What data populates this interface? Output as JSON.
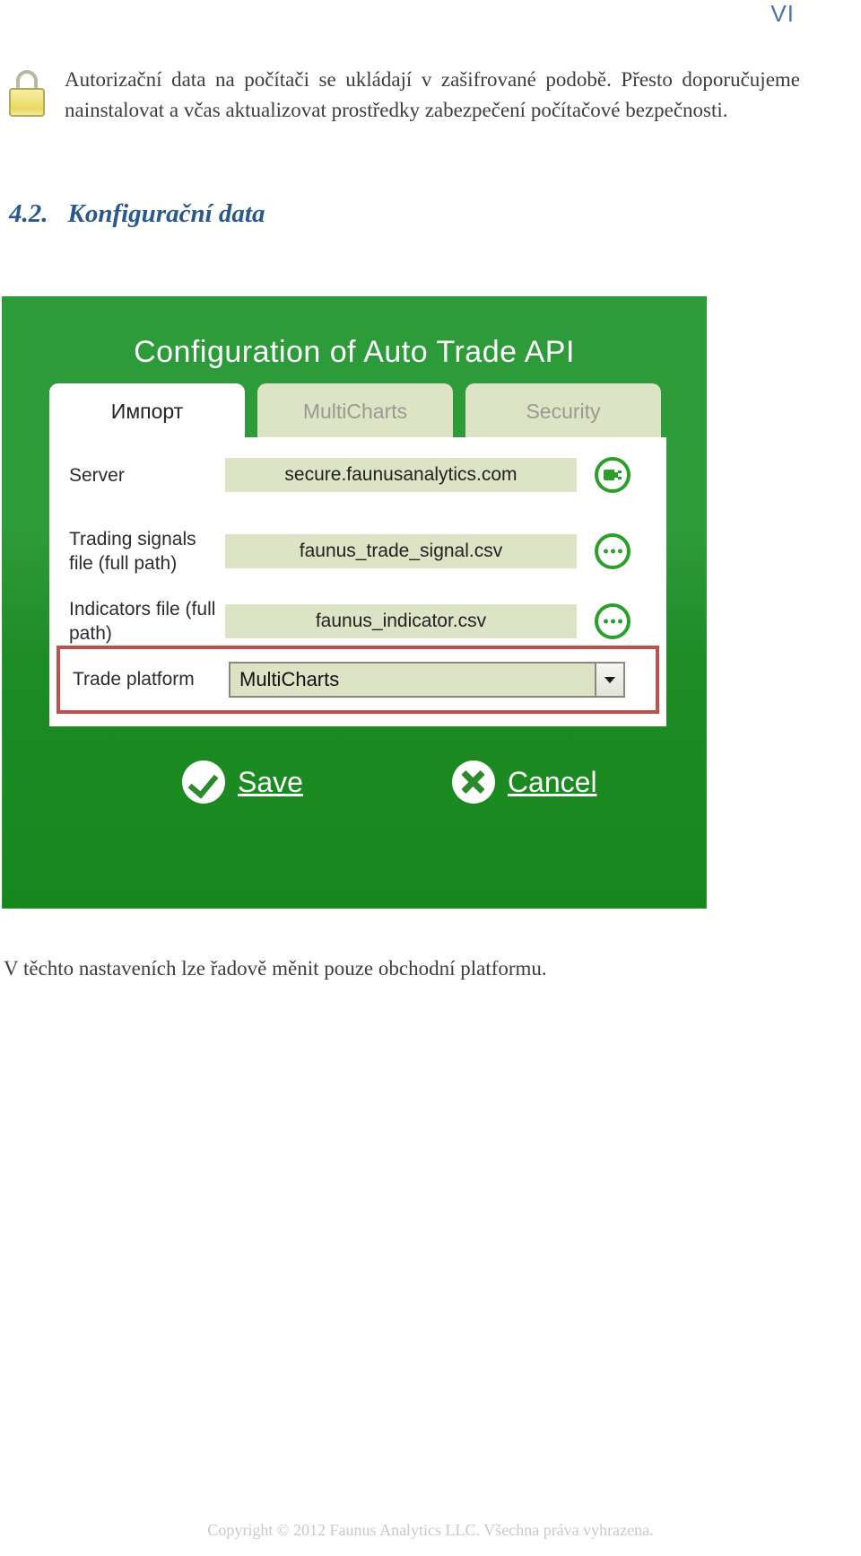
{
  "page": {
    "marker": "VI"
  },
  "note": {
    "icon": "padlock-icon",
    "text": "Autorizační data na počítači se ukládají v zašifrované podobě.  Přesto doporučujeme nainstalovat a včas aktualizovat prostředky zabezpečení počítačové bezpečnosti."
  },
  "heading": {
    "number": "4.2.",
    "title": "Konfigurační data"
  },
  "app": {
    "title": "Configuration of Auto Trade API",
    "tabs": [
      {
        "label": "Импорт",
        "active": true
      },
      {
        "label": "MultiCharts",
        "active": false
      },
      {
        "label": "Security",
        "active": false
      }
    ],
    "rows": [
      {
        "label": "Server",
        "value": "secure.faunusanalytics.com",
        "action_icon": "plug-connect-icon"
      },
      {
        "label": "Trading signals file (full path)",
        "value": "faunus_trade_signal.csv",
        "action_icon": "ellipsis-browse-icon"
      },
      {
        "label": "Indicators file (full path)",
        "value": "faunus_indicator.csv",
        "action_icon": "ellipsis-browse-icon"
      }
    ],
    "platform": {
      "label": "Trade platform",
      "value": "MultiCharts",
      "options": [
        "MultiCharts"
      ],
      "highlight_color": "#c0504d"
    },
    "buttons": {
      "save": "Save",
      "cancel": "Cancel"
    },
    "colors": {
      "green": "#2d9b3a",
      "field": "#dde3c5",
      "tab_inactive": "#dde3c5",
      "accent_red": "#c0504d"
    }
  },
  "caption": "V těchto nastaveních lze řadově měnit pouze obchodní platformu.",
  "footer": "Copyright © 2012 Faunus Analytics LLC. Všechna práva vyhrazena."
}
